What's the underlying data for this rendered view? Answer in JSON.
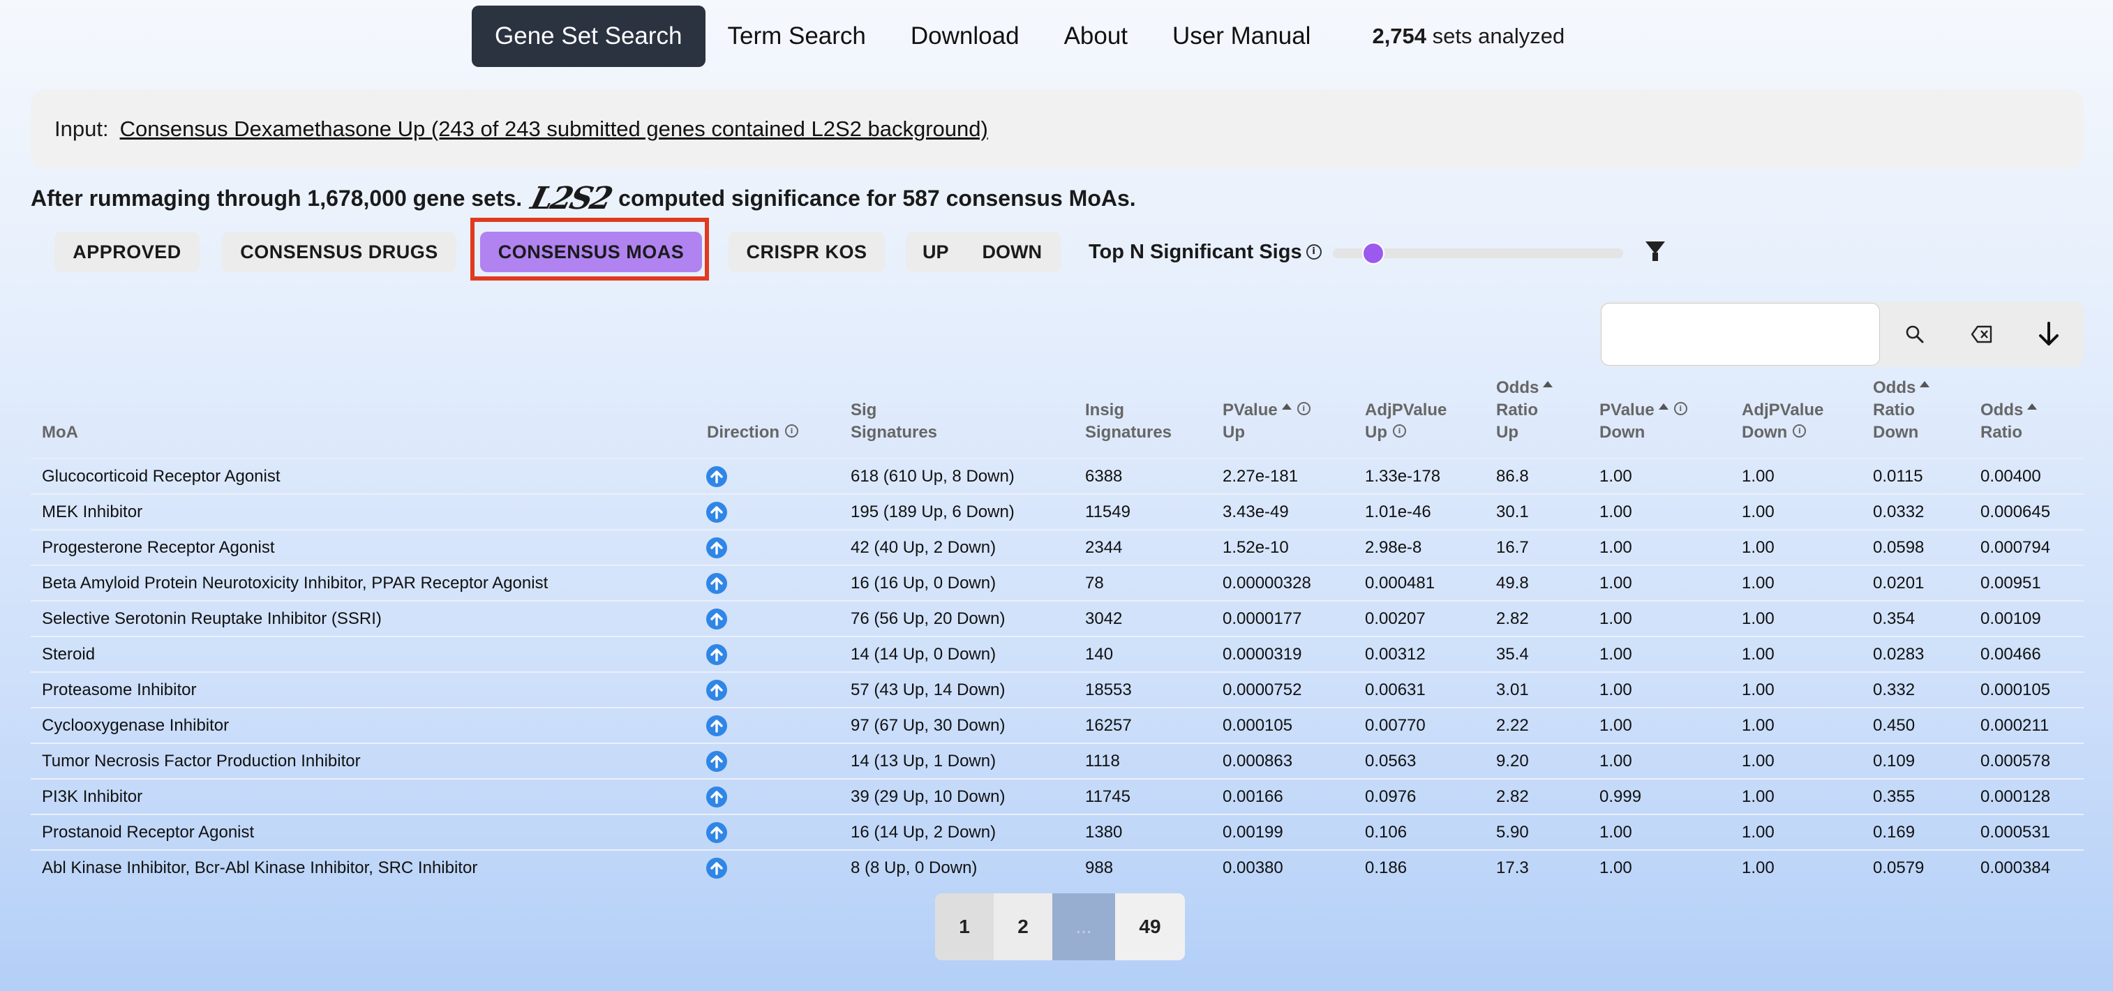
{
  "nav": {
    "items": [
      {
        "label": "Gene Set Search",
        "active": true
      },
      {
        "label": "Term Search"
      },
      {
        "label": "Download"
      },
      {
        "label": "About"
      },
      {
        "label": "User Manual"
      }
    ],
    "stat_count": "2,754",
    "stat_text": "sets analyzed"
  },
  "input": {
    "label": "Input:",
    "link": "Consensus Dexamethasone Up (243 of 243 submitted genes contained L2S2 background)"
  },
  "summary": {
    "before": "After rummaging through 1,678,000 gene sets.",
    "logo": "L2S2",
    "after": "computed significance for 587 consensus MoAs."
  },
  "filters": {
    "approved": "APPROVED",
    "consensus_drugs": "CONSENSUS DRUGS",
    "consensus_moas": "CONSENSUS MOAS",
    "crispr_kos": "CRISPR KOS",
    "up": "UP",
    "down": "DOWN",
    "topn_label": "Top N Significant Sigs",
    "slider_fraction": 0.14,
    "selected": "consensus_moas"
  },
  "search": {
    "value": "",
    "placeholder": ""
  },
  "icons": {
    "info": "info-icon",
    "filter": "funnel-icon",
    "search": "magnifier-icon",
    "clear": "backspace-icon",
    "download": "arrow-down-icon",
    "direction": "arrow-up-circle-icon"
  },
  "colors": {
    "accent": "#b083f0",
    "nav_active": "#2b3240",
    "direction": "#2f86e6",
    "highlight": "#e03a1e"
  },
  "table": {
    "headers": {
      "moa": "MoA",
      "direction": "Direction",
      "sig": [
        "Sig",
        "Signatures"
      ],
      "insig": [
        "Insig",
        "Signatures"
      ],
      "pvalue_up": [
        "PValue",
        "Up"
      ],
      "adjp_up": [
        "AdjPValue",
        "Up"
      ],
      "odds_up": [
        "Odds",
        "Ratio",
        "Up"
      ],
      "pvalue_down": [
        "PValue",
        "Down"
      ],
      "adjp_down": [
        "AdjPValue",
        "Down"
      ],
      "odds_down": [
        "Odds",
        "Ratio",
        "Down"
      ],
      "odds": [
        "Odds",
        "Ratio"
      ]
    },
    "rows": [
      {
        "moa": "Glucocorticoid Receptor Agonist",
        "direction": "up",
        "sig": "618 (610 Up, 8 Down)",
        "insig": "6388",
        "pu": "2.27e-181",
        "apu": "1.33e-178",
        "oru": "86.8",
        "pd": "1.00",
        "apd": "1.00",
        "ord": "0.0115",
        "or": "0.00400"
      },
      {
        "moa": "MEK Inhibitor",
        "direction": "up",
        "sig": "195 (189 Up, 6 Down)",
        "insig": "11549",
        "pu": "3.43e-49",
        "apu": "1.01e-46",
        "oru": "30.1",
        "pd": "1.00",
        "apd": "1.00",
        "ord": "0.0332",
        "or": "0.000645"
      },
      {
        "moa": "Progesterone Receptor Agonist",
        "direction": "up",
        "sig": "42 (40 Up, 2 Down)",
        "insig": "2344",
        "pu": "1.52e-10",
        "apu": "2.98e-8",
        "oru": "16.7",
        "pd": "1.00",
        "apd": "1.00",
        "ord": "0.0598",
        "or": "0.000794"
      },
      {
        "moa": "Beta Amyloid Protein Neurotoxicity Inhibitor, PPAR Receptor Agonist",
        "direction": "up",
        "sig": "16 (16 Up, 0 Down)",
        "insig": "78",
        "pu": "0.00000328",
        "apu": "0.000481",
        "oru": "49.8",
        "pd": "1.00",
        "apd": "1.00",
        "ord": "0.0201",
        "or": "0.00951"
      },
      {
        "moa": "Selective Serotonin Reuptake Inhibitor (SSRI)",
        "direction": "up",
        "sig": "76 (56 Up, 20 Down)",
        "insig": "3042",
        "pu": "0.0000177",
        "apu": "0.00207",
        "oru": "2.82",
        "pd": "1.00",
        "apd": "1.00",
        "ord": "0.354",
        "or": "0.00109"
      },
      {
        "moa": "Steroid",
        "direction": "up",
        "sig": "14 (14 Up, 0 Down)",
        "insig": "140",
        "pu": "0.0000319",
        "apu": "0.00312",
        "oru": "35.4",
        "pd": "1.00",
        "apd": "1.00",
        "ord": "0.0283",
        "or": "0.00466"
      },
      {
        "moa": "Proteasome Inhibitor",
        "direction": "up",
        "sig": "57 (43 Up, 14 Down)",
        "insig": "18553",
        "pu": "0.0000752",
        "apu": "0.00631",
        "oru": "3.01",
        "pd": "1.00",
        "apd": "1.00",
        "ord": "0.332",
        "or": "0.000105"
      },
      {
        "moa": "Cyclooxygenase Inhibitor",
        "direction": "up",
        "sig": "97 (67 Up, 30 Down)",
        "insig": "16257",
        "pu": "0.000105",
        "apu": "0.00770",
        "oru": "2.22",
        "pd": "1.00",
        "apd": "1.00",
        "ord": "0.450",
        "or": "0.000211"
      },
      {
        "moa": "Tumor Necrosis Factor Production Inhibitor",
        "direction": "up",
        "sig": "14 (13 Up, 1 Down)",
        "insig": "1118",
        "pu": "0.000863",
        "apu": "0.0563",
        "oru": "9.20",
        "pd": "1.00",
        "apd": "1.00",
        "ord": "0.109",
        "or": "0.000578"
      },
      {
        "moa": "PI3K Inhibitor",
        "direction": "up",
        "sig": "39 (29 Up, 10 Down)",
        "insig": "11745",
        "pu": "0.00166",
        "apu": "0.0976",
        "oru": "2.82",
        "pd": "0.999",
        "apd": "1.00",
        "ord": "0.355",
        "or": "0.000128"
      },
      {
        "moa": "Prostanoid Receptor Agonist",
        "direction": "up",
        "sig": "16 (14 Up, 2 Down)",
        "insig": "1380",
        "pu": "0.00199",
        "apu": "0.106",
        "oru": "5.90",
        "pd": "1.00",
        "apd": "1.00",
        "ord": "0.169",
        "or": "0.000531"
      },
      {
        "moa": "Abl Kinase Inhibitor, Bcr-Abl Kinase Inhibitor, SRC Inhibitor",
        "direction": "up",
        "sig": "8 (8 Up, 0 Down)",
        "insig": "988",
        "pu": "0.00380",
        "apu": "0.186",
        "oru": "17.3",
        "pd": "1.00",
        "apd": "1.00",
        "ord": "0.0579",
        "or": "0.000384"
      }
    ]
  },
  "pagination": {
    "pages": [
      "1",
      "2",
      "...",
      "49"
    ],
    "current": "1"
  }
}
